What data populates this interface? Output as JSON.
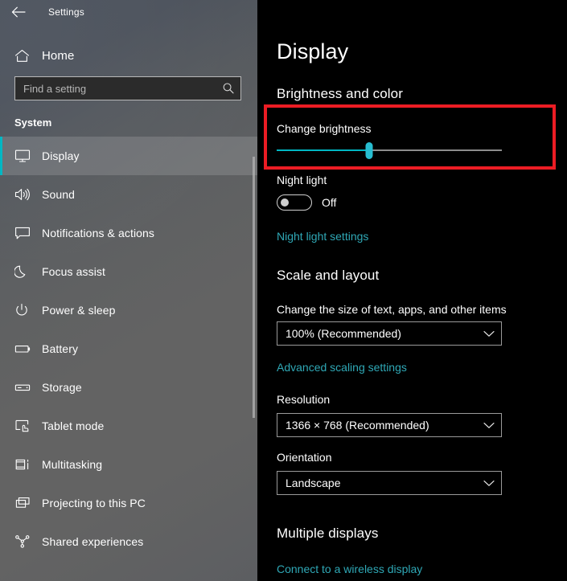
{
  "titlebar": {
    "back_icon": "back-arrow-icon",
    "title": "Settings"
  },
  "sidebar": {
    "home_label": "Home",
    "home_icon": "home-icon",
    "search": {
      "placeholder": "Find a setting",
      "value": "",
      "icon": "search-icon"
    },
    "section_title": "System",
    "accent_color": "#00b7c3",
    "items": [
      {
        "label": "Display",
        "icon": "monitor-icon",
        "selected": true
      },
      {
        "label": "Sound",
        "icon": "speaker-icon",
        "selected": false
      },
      {
        "label": "Notifications & actions",
        "icon": "callout-icon",
        "selected": false
      },
      {
        "label": "Focus assist",
        "icon": "moon-icon",
        "selected": false
      },
      {
        "label": "Power & sleep",
        "icon": "power-icon",
        "selected": false
      },
      {
        "label": "Battery",
        "icon": "battery-icon",
        "selected": false
      },
      {
        "label": "Storage",
        "icon": "drive-icon",
        "selected": false
      },
      {
        "label": "Tablet mode",
        "icon": "tablet-touch-icon",
        "selected": false
      },
      {
        "label": "Multitasking",
        "icon": "multitasking-icon",
        "selected": false
      },
      {
        "label": "Projecting to this PC",
        "icon": "projecting-icon",
        "selected": false
      },
      {
        "label": "Shared experiences",
        "icon": "share-nodes-icon",
        "selected": false
      }
    ]
  },
  "main": {
    "page_title": "Display",
    "brightness_group": {
      "heading": "Brightness and color",
      "change_brightness_label": "Change brightness",
      "slider_percent": 41,
      "slider_fill_color": "#00b7c3",
      "highlight_color": "#ec1c24"
    },
    "night_light": {
      "label": "Night light",
      "state": "Off",
      "settings_link": "Night light settings"
    },
    "scale_group": {
      "heading": "Scale and layout",
      "scale_label": "Change the size of text, apps, and other items",
      "scale_value": "100% (Recommended)",
      "advanced_link": "Advanced scaling settings",
      "resolution_label": "Resolution",
      "resolution_value": "1366 × 768 (Recommended)",
      "orientation_label": "Orientation",
      "orientation_value": "Landscape",
      "dropdown_icon": "chevron-down-icon"
    },
    "multiple_displays": {
      "heading": "Multiple displays",
      "wireless_link": "Connect to a wireless display"
    }
  }
}
